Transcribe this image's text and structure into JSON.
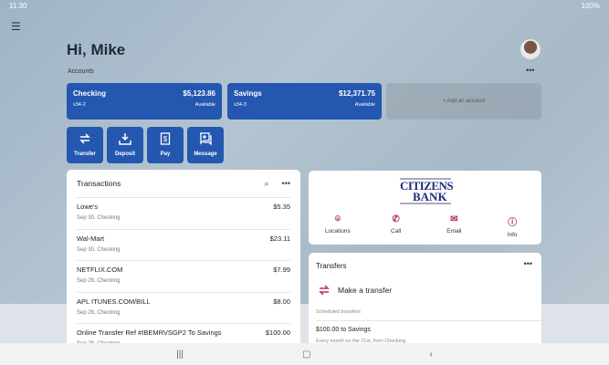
{
  "status": {
    "time": "11:30",
    "battery": "100%"
  },
  "greeting": "Hi, Mike",
  "accounts_label": "Accounts",
  "accounts": [
    {
      "name": "Checking",
      "balance": "$5,123.86",
      "suffix": "x34-2",
      "status": "Available"
    },
    {
      "name": "Savings",
      "balance": "$12,371.75",
      "suffix": "x34-3",
      "status": "Available"
    }
  ],
  "add_account": "+ Add an account",
  "quick_actions": [
    {
      "label": "Transfer"
    },
    {
      "label": "Deposit"
    },
    {
      "label": "Pay"
    },
    {
      "label": "Message"
    }
  ],
  "transactions": {
    "title": "Transactions",
    "items": [
      {
        "merchant": "Lowe's",
        "detail": "Sep 30, Checking",
        "amount": "$5.35"
      },
      {
        "merchant": "Wal-Mart",
        "detail": "Sep 30, Checking",
        "amount": "$23.11"
      },
      {
        "merchant": "NETFLIX.COM",
        "detail": "Sep 29, Checking",
        "amount": "$7.99"
      },
      {
        "merchant": "APL ITUNES.COM/BILL",
        "detail": "Sep 28, Checking",
        "amount": "$8.00"
      },
      {
        "merchant": "Online Transfer Ref #IBEMRVSGP2 To Savings",
        "detail": "Sep 28, Checking",
        "amount": "$100.00"
      }
    ]
  },
  "bank": {
    "logo_line1": "CITIZENS",
    "logo_line2": "BANK",
    "actions": [
      {
        "label": "Locations"
      },
      {
        "label": "Call"
      },
      {
        "label": "Email"
      },
      {
        "label": "Info"
      }
    ],
    "accent": "#b0305a"
  },
  "transfers": {
    "title": "Transfers",
    "make": "Make a transfer",
    "scheduled_label": "Scheduled transfers",
    "scheduled": [
      {
        "title": "$100.00 to Savings",
        "detail": "Every month on the 21st, from Checking"
      }
    ]
  },
  "colors": {
    "primary": "#2457b0"
  }
}
